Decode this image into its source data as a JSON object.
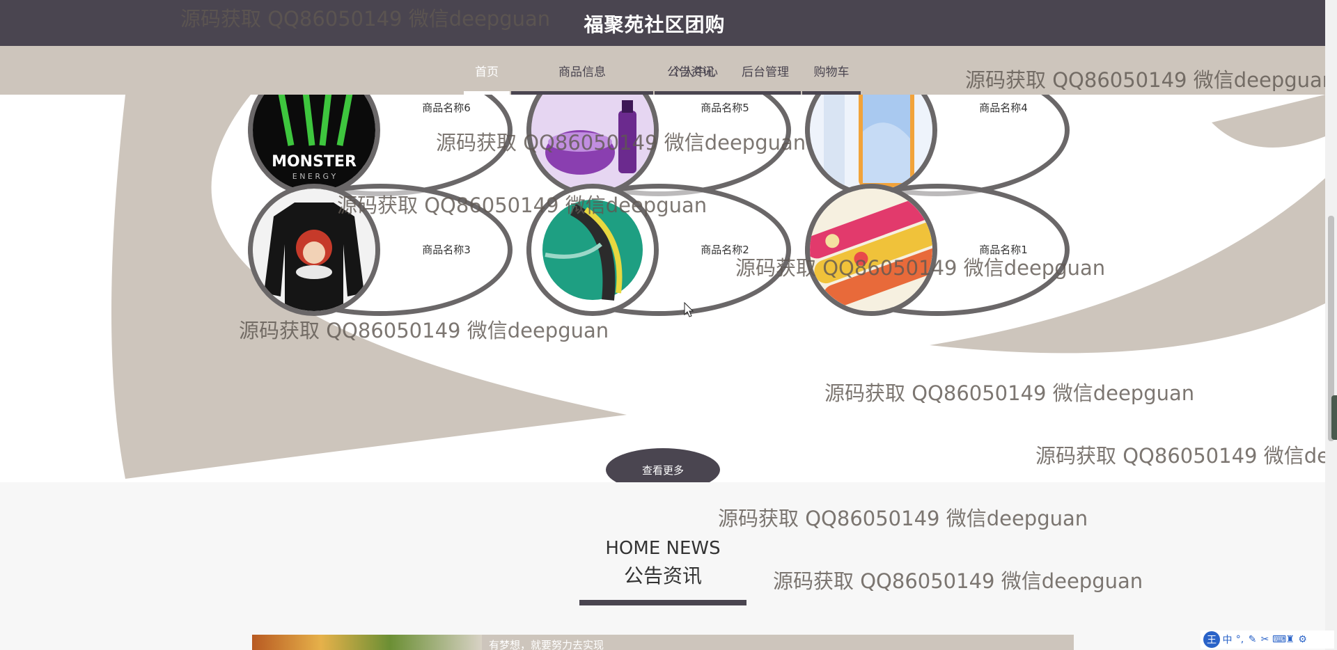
{
  "header": {
    "site_title": "福聚苑社区团购",
    "nav": [
      {
        "label": "首页",
        "active": true
      },
      {
        "label": "商品信息"
      },
      {
        "label": "公告资讯"
      },
      {
        "label": "个人中心"
      },
      {
        "label": "后台管理"
      },
      {
        "label": "购物车"
      }
    ]
  },
  "products": {
    "items": [
      {
        "name": "商品名称6",
        "image": "monster-energy-can"
      },
      {
        "name": "商品名称5",
        "image": "purple-cosmetics"
      },
      {
        "name": "商品名称4",
        "image": "smartphone"
      },
      {
        "name": "商品名称3",
        "image": "black-printed-shirt"
      },
      {
        "name": "商品名称2",
        "image": "green-soccer-ball"
      },
      {
        "name": "商品名称1",
        "image": "snack-tubes"
      }
    ],
    "more_label": "查看更多"
  },
  "news": {
    "heading_en": "HOME NEWS",
    "heading_cn": "公告资讯",
    "items": [
      {
        "title": "有梦想，就要努力去实现"
      }
    ]
  },
  "watermark": {
    "text": "源码获取 QQ86050149 微信deepguan"
  },
  "ime_toolbar": {
    "logo": "王",
    "lang": "中"
  },
  "colors": {
    "header_bg": "#4a4550",
    "nav_bg": "#cdc5bc",
    "accent": "#4a4550",
    "ring": "#6a6768"
  }
}
